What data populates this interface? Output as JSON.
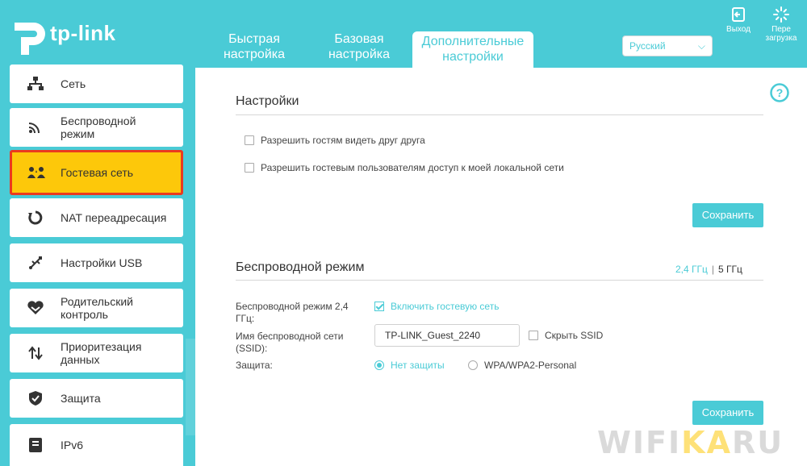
{
  "brand": {
    "name": "tp-link"
  },
  "tabs": [
    {
      "label": "Быстрая настройка",
      "active": false
    },
    {
      "label": "Базовая настройка",
      "active": false
    },
    {
      "label": "Дополнительные настройки",
      "active": true
    }
  ],
  "language": {
    "selected": "Русский"
  },
  "header_buttons": {
    "logout": "Выход",
    "reboot_line1": "Пере",
    "reboot_line2": "загрузка"
  },
  "sidebar": {
    "items": [
      {
        "label": "Сеть",
        "icon": "network-icon",
        "active": false
      },
      {
        "label": "Беспроводной режим",
        "icon": "wireless-icon",
        "active": false
      },
      {
        "label": "Гостевая сеть",
        "icon": "guest-network-icon",
        "active": true
      },
      {
        "label": "NAT переадресация",
        "icon": "nat-icon",
        "active": false
      },
      {
        "label": "Настройки USB",
        "icon": "usb-icon",
        "active": false
      },
      {
        "label": "Родительский контроль",
        "icon": "parental-control-icon",
        "active": false
      },
      {
        "label": "Приоритезация данных",
        "icon": "qos-icon",
        "active": false
      },
      {
        "label": "Защита",
        "icon": "shield-icon",
        "active": false
      },
      {
        "label": "IPv6",
        "icon": "ipv6-icon",
        "active": false
      }
    ]
  },
  "settings": {
    "title": "Настройки",
    "allow_guests_see_each_other": "Разрешить гостям видеть друг друга",
    "allow_guests_local_access": "Разрешить гостевым пользователям доступ к моей локальной сети",
    "save_label": "Сохранить"
  },
  "wireless": {
    "title": "Беспроводной режим",
    "band_24": "2,4 ГГц",
    "band_separator": "|",
    "band_5": "5 ГГц",
    "mode_label": "Беспроводной режим 2,4 ГГц:",
    "enable_guest_label": "Включить гостевую сеть",
    "ssid_label": "Имя беспроводной сети (SSID):",
    "ssid_value": "TP-LINK_Guest_2240",
    "hide_ssid_label": "Скрыть SSID",
    "security_label": "Защита:",
    "security_options": [
      "Нет защиты",
      "WPA/WPA2-Personal"
    ],
    "security_selected": "Нет защиты",
    "save_label": "Сохранить"
  },
  "watermark": {
    "left": "WIFI",
    "mid": "KA",
    "right": "RU"
  },
  "colors": {
    "accent": "#4acbd6",
    "active_item": "#fdc80a",
    "highlight_border": "#ea3a1f"
  }
}
